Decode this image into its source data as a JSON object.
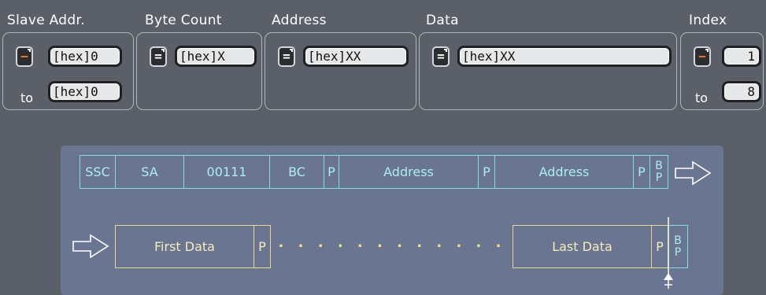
{
  "headers": {
    "slave_addr": "Slave Addr.",
    "byte_count": "Byte Count",
    "address": "Address",
    "data": "Data",
    "index": "Index"
  },
  "slave_addr": {
    "from_value": "[hex]0",
    "to_label": "to",
    "to_value": "[hex]0"
  },
  "byte_count": {
    "value": "[hex]X"
  },
  "address": {
    "value": "[hex]XX"
  },
  "data": {
    "value": "[hex]XX"
  },
  "index": {
    "from_value": "1",
    "to_label": "to",
    "to_value": "8"
  },
  "operators": {
    "range": "[-]",
    "equal": "="
  },
  "frame": {
    "row1": {
      "ssc": "SSC",
      "sa": "SA",
      "cmd": "00111",
      "bc": "BC",
      "p1": "P",
      "address1": "Address",
      "p2": "P",
      "address2": "Address",
      "p3": "P",
      "bp_b": "B",
      "bp_p": "P"
    },
    "row2": {
      "first_data": "First Data",
      "p1": "P",
      "dots": ". . . . . . . . . . . .",
      "last_data": "Last Data",
      "p2": "P",
      "bp_b": "B",
      "bp_p": "P"
    },
    "colors": {
      "row1": "#7fe3e6",
      "row2": "#e6d98a",
      "panel": "#6a7691",
      "range_operator": "#f07b2a"
    }
  }
}
